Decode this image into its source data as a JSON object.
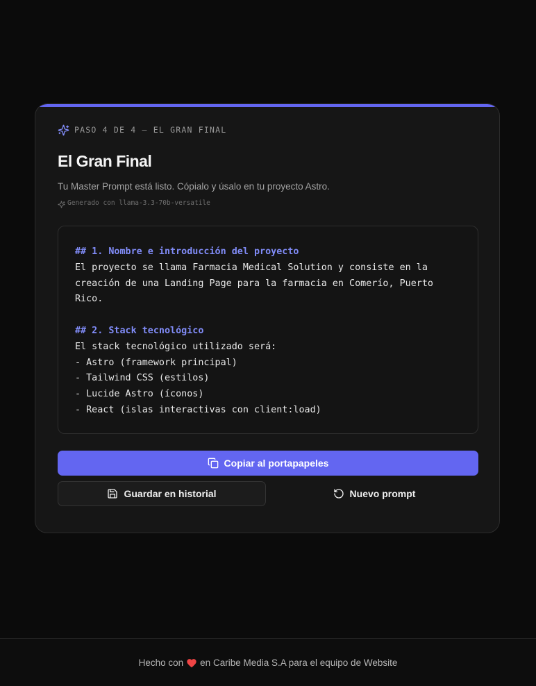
{
  "card": {
    "step_label": "PASO 4 DE 4 — EL GRAN FINAL",
    "title": "El Gran Final",
    "subtitle": "Tu Master Prompt está listo. Cópialo y úsalo en tu proyecto Astro.",
    "model_label": "Generado con llama-3.3-70b-versatile",
    "step_icon": "sparkles-icon",
    "model_icon": "sparkles-icon"
  },
  "prompt": {
    "lines": [
      "## 1. Nombre e introducción del proyecto",
      "El proyecto se llama Farmacia Medical Solution y consiste en la",
      "creación de una Landing Page para la farmacia en Comerío, Puerto",
      "Rico.",
      "",
      "## 2. Stack tecnológico",
      "El stack tecnológico utilizado será:",
      "- Astro (framework principal)",
      "- Tailwind CSS (estilos)",
      "- Lucide Astro (íconos)",
      "- React (islas interactivas con client:load)"
    ]
  },
  "actions": {
    "copy_label": "Copiar al portapapeles",
    "copy_icon": "copy-icon",
    "save_label": "Guardar en historial",
    "save_icon": "save-icon",
    "new_label": "Nuevo prompt",
    "new_icon": "rotate-ccw-icon"
  },
  "footer": {
    "prefix": "Hecho con",
    "suffix": "en Caribe Media S.A para el equipo de Website",
    "heart_icon": "heart-icon"
  },
  "colors": {
    "accent": "#6366f1",
    "heading_text": "#818cf8",
    "heart": "#ef4444",
    "background": "#0b0b0b",
    "card": "#161616"
  }
}
